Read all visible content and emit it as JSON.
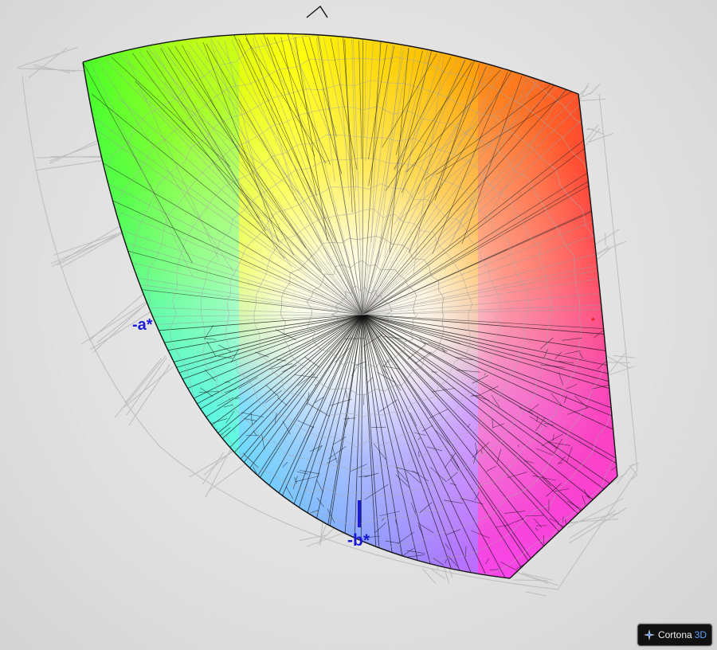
{
  "axes": {
    "neg_a": "-a*",
    "pos_a": "*",
    "neg_b": "-b*"
  },
  "colors": {
    "neg_axis": "#1a1ad8",
    "pos_axis": "#e41a1a",
    "outer_wire": "#bdbdbd",
    "inner_wire": "#000000",
    "background": "#e0e0e0"
  },
  "viewer": {
    "brand_name": "Cortona",
    "brand_suffix": "3D"
  }
}
